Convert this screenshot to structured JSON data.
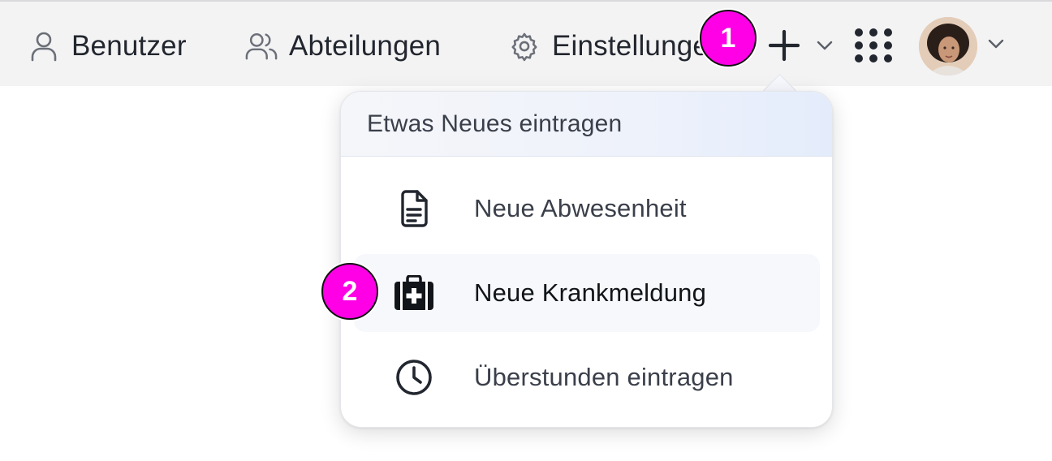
{
  "nav": {
    "items": [
      {
        "label": "Benutzer",
        "icon": "user-icon"
      },
      {
        "label": "Abteilungen",
        "icon": "users-icon"
      },
      {
        "label": "Einstellungen",
        "icon": "gear-icon"
      }
    ]
  },
  "toolbar": {
    "add_icon": "plus-icon",
    "add_chevron_icon": "chevron-down-icon",
    "apps_icon": "grid-icon",
    "avatar_chevron_icon": "chevron-down-icon"
  },
  "menu": {
    "header": "Etwas Neues eintragen",
    "items": [
      {
        "label": "Neue Abwesenheit",
        "icon": "document-icon"
      },
      {
        "label": "Neue Krankmeldung",
        "icon": "medical-kit-icon",
        "highlighted": true
      },
      {
        "label": "Überstunden eintragen",
        "icon": "clock-icon"
      }
    ]
  },
  "annotations": {
    "step1": "1",
    "step2": "2"
  },
  "colors": {
    "topbar_bg": "#f3f3f4",
    "badge": "#ff00e6",
    "text": "#22262e"
  }
}
